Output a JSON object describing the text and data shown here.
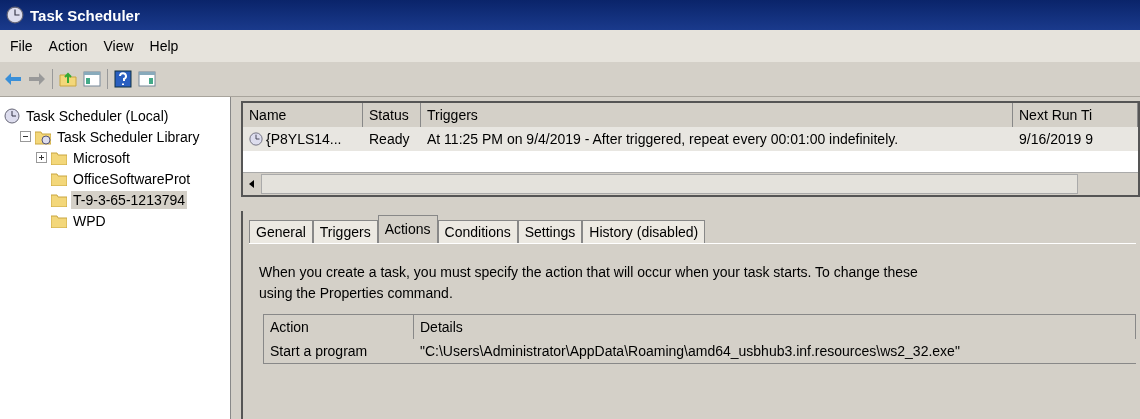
{
  "window": {
    "title": "Task Scheduler"
  },
  "menu": [
    "File",
    "Action",
    "View",
    "Help"
  ],
  "toolbar": [
    {
      "kind": "back"
    },
    {
      "kind": "forward"
    },
    {
      "kind": "sep"
    },
    {
      "kind": "folder-up"
    },
    {
      "kind": "pane"
    },
    {
      "kind": "sep"
    },
    {
      "kind": "help"
    },
    {
      "kind": "pane2"
    }
  ],
  "tree": [
    {
      "label": "Task Scheduler (Local)",
      "kind": "clock",
      "selected": false,
      "children": [
        {
          "label": "Task Scheduler Library",
          "kind": "library",
          "selected": false,
          "expanded": true,
          "children": [
            {
              "label": "Microsoft",
              "kind": "folder",
              "selected": false,
              "expanded": false
            },
            {
              "label": "OfficeSoftwareProt",
              "kind": "folder",
              "selected": false
            },
            {
              "label": "T-9-3-65-1213794",
              "kind": "folder",
              "selected": true
            },
            {
              "label": "WPD",
              "kind": "folder",
              "selected": false
            }
          ]
        }
      ]
    }
  ],
  "task_list": {
    "columns": [
      "Name",
      "Status",
      "Triggers",
      "Next Run Ti"
    ],
    "rows": [
      {
        "selected": true,
        "cells": [
          "{P8YLS14...",
          "Ready",
          "At 11:25 PM on 9/4/2019 - After triggered, repeat every 00:01:00 indefinitely.",
          "9/16/2019 9"
        ]
      }
    ]
  },
  "tabs": [
    {
      "label": "General",
      "selected": false
    },
    {
      "label": "Triggers",
      "selected": false
    },
    {
      "label": "Actions",
      "selected": true
    },
    {
      "label": "Conditions",
      "selected": false
    },
    {
      "label": "Settings",
      "selected": false
    },
    {
      "label": "History (disabled)",
      "selected": false
    }
  ],
  "description": "When you create a task, you must specify the action that will occur when your task starts.  To change these",
  "description_line2": "using the Properties command.",
  "actions_table": {
    "columns": [
      "Action",
      "Details"
    ],
    "rows": [
      [
        "Start a program",
        "\"C:\\Users\\Administrator\\AppData\\Roaming\\amd64_usbhub3.inf.resources\\ws2_32.exe\""
      ]
    ]
  }
}
